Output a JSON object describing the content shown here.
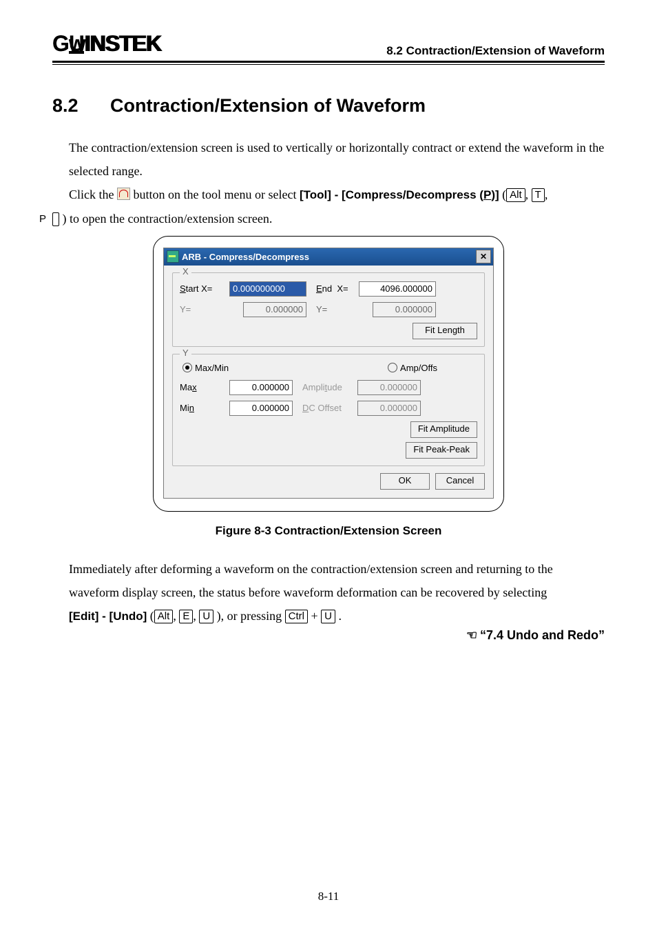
{
  "header": {
    "brand": "GᴷINSTEK",
    "section": "8.2 Contraction/Extension of Waveform"
  },
  "title": {
    "num": "8.2",
    "text": "Contraction/Extension of Waveform"
  },
  "intro": {
    "p1": "The contraction/extension screen is used to vertically or horizontally contract or extend the waveform in the selected range.",
    "p2a": "Click the ",
    "p2b": " button on the tool menu or select ",
    "menu_path": "[Tool] - [Compress/Decompress (",
    "menu_hot": "P",
    "menu_end": ")]",
    "p2c": " (",
    "k1": "Alt",
    "k2": "T",
    "k3": "P",
    "p2d": " ) to open the contraction/extension screen."
  },
  "dialog": {
    "title": "ARB - Compress/Decompress",
    "x": {
      "legend": "X",
      "startx_lbl": "Start X=",
      "startx_val": "0.000000000",
      "endx_lbl": "End  X=",
      "endx_val": "4096.000000",
      "y1_lbl": "Y=",
      "y1_val": "0.000000",
      "y2_lbl": "Y=",
      "y2_val": "0.000000",
      "fit_btn": "Fit Length"
    },
    "y": {
      "legend": "Y",
      "r1": "Max/Min",
      "r2": "Amp/Offs",
      "max_lbl": "Max",
      "max_val": "0.000000",
      "amp_lbl": "Amplitude",
      "amp_val": "0.000000",
      "min_lbl": "Min",
      "min_val": "0.000000",
      "dco_lbl": "DC Offset",
      "dco_val": "0.000000",
      "fit_amp": "Fit Amplitude",
      "fit_pp": "Fit Peak-Peak"
    },
    "ok": "OK",
    "cancel": "Cancel"
  },
  "caption": "Figure 8-3 Contraction/Extension Screen",
  "after": {
    "p1": "Immediately after deforming a waveform on the contraction/extension screen and returning to the waveform display screen, the status before waveform deformation can be recovered by selecting ",
    "menu": "[Edit] - [Undo]",
    "open": " (",
    "k1": "Alt",
    "c": ", ",
    "k2": "E",
    "k3": "U",
    "mid": " ), or pressing  ",
    "k4": "Ctrl",
    "plus": " + ",
    "k5": "U",
    "end": " ."
  },
  "xref": "“7.4 Undo and Redo”",
  "pagenum": "8-11"
}
